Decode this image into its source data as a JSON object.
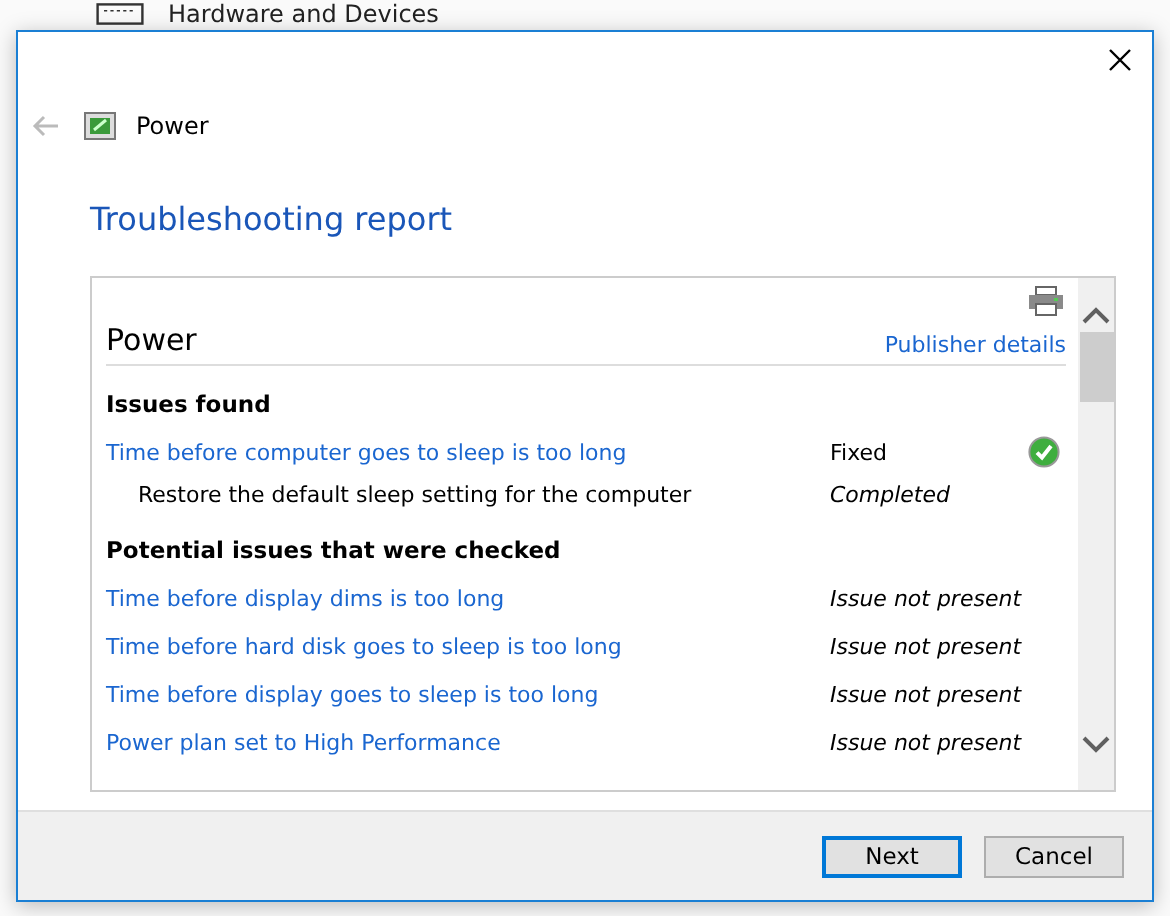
{
  "background": {
    "heading": "Hardware and Devices"
  },
  "window": {
    "title": "Power",
    "back_disabled": true
  },
  "heading": "Troubleshooting report",
  "report": {
    "title": "Power",
    "publisher_link": "Publisher details",
    "sections": [
      {
        "heading": "Issues found",
        "items": [
          {
            "kind": "issue",
            "label": "Time before computer goes to sleep is too long",
            "status": "Fixed",
            "fixed": true
          },
          {
            "kind": "action",
            "label": "Restore the default sleep setting for the computer",
            "status": "Completed"
          }
        ]
      },
      {
        "heading": "Potential issues that were checked",
        "items": [
          {
            "kind": "issue",
            "label": "Time before display dims is too long",
            "status": "Issue not present",
            "fixed": false
          },
          {
            "kind": "issue",
            "label": "Time before hard disk goes to sleep is too long",
            "status": "Issue not present",
            "fixed": false
          },
          {
            "kind": "issue",
            "label": "Time before display goes to sleep is too long",
            "status": "Issue not present",
            "fixed": false
          },
          {
            "kind": "issue",
            "label": "Power plan set to High Performance",
            "status": "Issue not present",
            "fixed": false
          }
        ]
      }
    ]
  },
  "buttons": [
    {
      "label": "Next",
      "default": true
    },
    {
      "label": "Cancel",
      "default": false
    }
  ]
}
